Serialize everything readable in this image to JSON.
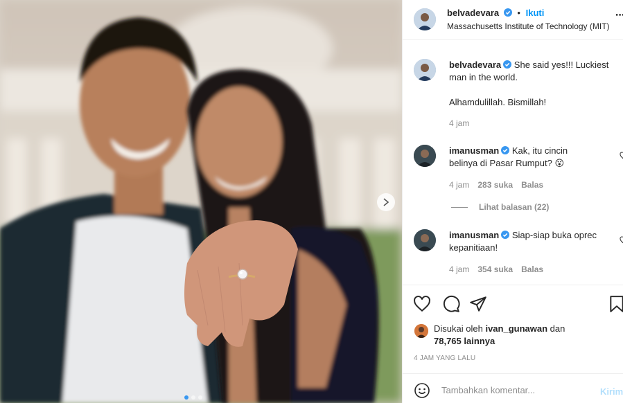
{
  "photo": {
    "alt_subject": "couple showing engagement ring",
    "carousel_dots": 3,
    "active_dot": 1
  },
  "header": {
    "username": "belvadevara",
    "separator": "•",
    "follow_label": "Ikuti",
    "location": "Massachusetts Institute of Technology (MIT)",
    "more_icon": "more-options-icon"
  },
  "caption": {
    "username": "belvadevara",
    "text_line1": "She said yes!!! Luckiest",
    "text_line2": "man in the world.",
    "text_line3": "Alhamdulillah. Bismillah!",
    "time": "4 jam"
  },
  "comments": [
    {
      "username": "imanusman",
      "text_line1": "Kak, itu cincin",
      "text_line2": "belinya di Pasar Rumput? 😮",
      "time": "4 jam",
      "likes": "283 suka",
      "reply": "Balas"
    },
    {
      "username": "imanusman",
      "text_line1": "Siap-siap buka oprec",
      "text_line2": "kepanitiaan!",
      "time": "4 jam",
      "likes": "354 suka",
      "reply": "Balas"
    }
  ],
  "view_replies": "Lihat balasan (22)",
  "likes": {
    "prefix": "Disukai oleh",
    "user": "ivan_gunawan",
    "and": "dan",
    "count": "78,765 lainnya"
  },
  "post_time": "4 JAM YANG LALU",
  "add_comment": {
    "placeholder": "Tambahkan komentar...",
    "post_label": "Kirim"
  },
  "colors": {
    "accent": "#0095f6",
    "verified": "#3897f0",
    "muted": "#8e8e8e"
  }
}
